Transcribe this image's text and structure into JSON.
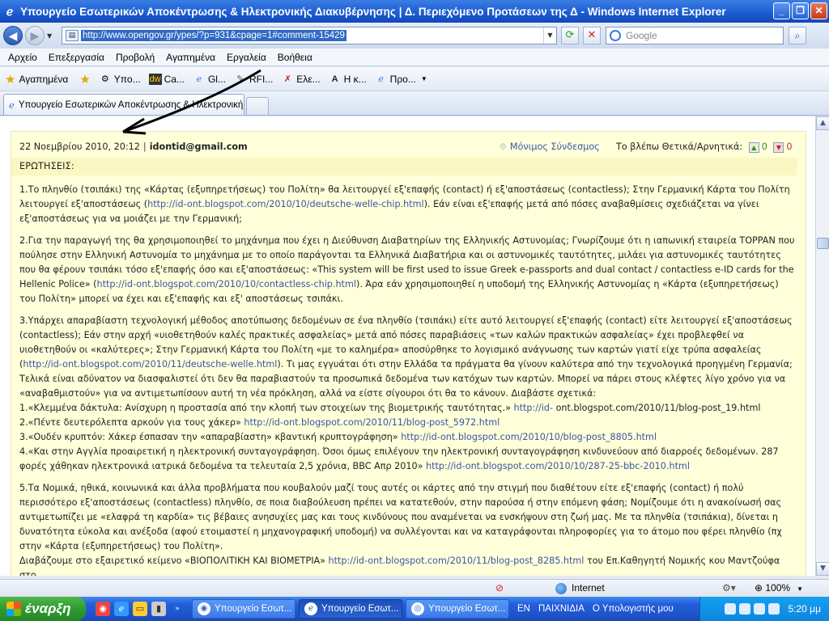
{
  "window": {
    "title": "Υπουργείο Εσωτερικών Αποκέντρωσης & Ηλεκτρονικής Διακυβέρνησης | Δ. Περιεχόμενο Προτάσεων της Δ - Windows Internet Explorer",
    "min": "_",
    "max": "❐",
    "close": "✕"
  },
  "address": {
    "url": "http://www.opengov.gr/ypes/?p=931&cpage=1#comment-15429",
    "search_placeholder": "Google"
  },
  "menu": [
    "Αρχείο",
    "Επεξεργασία",
    "Προβολή",
    "Αγαπημένα",
    "Εργαλεία",
    "Βοήθεια"
  ],
  "favorites": {
    "label": "Αγαπημένα",
    "items": [
      "Υπο...",
      "Ca...",
      "Gl...",
      "RFI...",
      "Ελε...",
      "Η κ...",
      "Προ..."
    ]
  },
  "tab": {
    "title": "Υπουργείο Εσωτερικών Αποκέντρωσης & Ηλεκτρονική..."
  },
  "comment": {
    "date": "22 Νοεμβρίου 2010, 20:12",
    "sep": "|",
    "author": "idontid@gmail.com",
    "permalink": "Μόνιμος Σύνδεσμος",
    "vote_label": "Το βλέπω Θετικά/Αρνητικά:",
    "up": "0",
    "down": "0",
    "heading": "ΕΡΩΤΗΣΕΙΣ:",
    "p1a": "1.Το πληνθίο (τσιπάκι) της «Κάρτας (εξυπηρετήσεως) του Πολίτη» θα λειτουργεί εξ'επαφής (contact) ή εξ'αποστάσεως (contactless); Στην Γερμανική Κάρτα του Πολίτη λειτουργεί εξ'αποστάσεως (",
    "p1link": "http://id-ont.blogspot.com/2010/10/deutsche-welle-chip.html",
    "p1b": "). Εάν είναι εξ'επαφής μετά από πόσες αναβαθμίσεις σχεδιάζεται να γίνει εξ'αποστάσεως για να μοιάζει με την Γερμανική;",
    "p2a": "2.Για την παραγωγή της θα χρησιμοποιηθεί το μηχάνημα που έχει η Διεύθυνση Διαβατηρίων της Ελληνικής Αστυνομίας; Γνωρίζουμε ότι η ιαπωνική εταιρεία TOPPAN που πούλησε στην Ελληνική Αστυνομία το μηχάνημα με το οποίο παράγονται τα Ελληνικά Διαβατήρια και οι αστυνομικές ταυτότητες, μιλάει για αστυνομικές ταυτότητες που θα φέρουν τσιπάκι τόσο εξ'επαφής όσο και εξ'αποστάσεως: «This system will be first used to issue Greek e-passports and dual contact / contactless e-ID cards for the Hellenic Police» (",
    "p2link": "http://id-ont.blogspot.com/2010/10/contactless-chip.html",
    "p2b": "). Άρα εάν χρησιμοποιηθεί η υποδομή της Ελληνικής Αστυνομίας η «Κάρτα (εξυπηρετήσεως) του Πολίτη» μπορεί να έχει και εξ'επαφής και εξ' αποστάσεως τσιπάκι.",
    "p3a": "3.Υπάρχει απαραβίαστη τεχνολογική μέθοδος αποτύπωσης δεδομένων σε ένα πληνθίο (τσιπάκι) είτε αυτό λειτουργεί εξ'επαφής (contact) είτε λειτουργεί εξ'αποστάσεως (contactless); Εάν στην αρχή «υιοθετηθούν καλές πρακτικές ασφαλείας» μετά από πόσες παραβιάσεις «των καλών πρακτικών ασφαλείας» έχει προβλεφθεί να υιοθετηθούν οι «καλύτερες»; Στην Γερμανική Κάρτα του Πολίτη «με το καλημέρα» αποσύρθηκε το λογισμικό ανάγνωσης των καρτών γιατί είχε τρύπα ασφαλείας (",
    "p3link": "http://id-ont.blogspot.com/2010/11/deutsche-welle.html",
    "p3b": "). Τι μας εγγυάται ότι στην Ελλάδα τα πράγματα θα γίνουν καλύτερα από την τεχνολογικά προηγμένη Γερμανία; Τελικά είναι αδύνατον να διασφαλιστεί ότι δεν θα παραβιαστούν τα προσωπικά δεδομένα των κατόχων των καρτών. Μπορεί να πάρει στους κλέφτες λίγο χρόνο για να «αναβαθμιστούν» για να αντιμετωπίσουν αυτή τη νέα πρόκληση, αλλά να είστε σίγουροι ότι θα το κάνουν. Διαβάστε σχετικά:",
    "l1a": "1.«Κλεμμένα δάκτυλα: Ανίσχυρη η προστασία από την κλοπή των στοιχείων της βιομετρικής ταυτότητας.» ",
    "l1link": "http://id-",
    "l1b": " ont.blogspot.com/2010/11/blog-post_19.html",
    "l2a": "2.«Πέντε δευτερόλεπτα αρκούν για τους χάκερ» ",
    "l2link": "http://id-ont.blogspot.com/2010/11/blog-post_5972.html",
    "l3a": "3.«Ουδέν κρυπτόν: Χάκερ έσπασαν την «απαραβίαστη» κβαντική κρυπτογράφηση» ",
    "l3link": "http://id-ont.blogspot.com/2010/10/blog-post_8805.html",
    "l4a": "4.«Και στην Αγγλία προαιρετική η ηλεκτρονική συνταγογράφηση. Όσοι όμως επιλέγουν την ηλεκτρονική συνταγογράφηση κινδυνεύουν από διαρροές δεδομένων. 287 φορές χάθηκαν ηλεκτρονικά ιατρικά δεδομένα τα τελευταία 2,5 χρόνια, BBC Απρ 2010» ",
    "l4link": "http://id-ont.blogspot.com/2010/10/287-25-bbc-2010.html",
    "p5": "5.Τα Νομικά, ηθικά, κοινωνικά και άλλα προβλήματα που κουβαλούν μαζί τους αυτές οι κάρτες από την στιγμή που διαθέτουν είτε εξ'επαφής (contact) ή πολύ περισσότερο εξ'αποστάσεως (contactless) πληνθίο, σε ποια διαβούλευση πρέπει να κατατεθούν, στην παρούσα ή στην επόμενη φάση; Νομίζουμε ότι η ανακοίνωσή σας αντιμετωπίζει με «ελαφρά τη καρδία» τις βέβαιες ανησυχίες μας και τους κινδύνους που αναμένεται να ενσκήψουν στη ζωή μας. Με τα πληνθία (τσιπάκια), δίνεται η δυνατότητα εύκολα και ανέξοδα (αφού ετοιμαστεί η μηχανογραφική υποδομή) να συλλέγονται και να καταγράφονται πληροφορίες για το άτομο που φέρει πληνθίο (πχ στην «Κάρτα (εξυπηρετήσεως) του Πολίτη».",
    "p6a": "Διαβάζουμε στο εξαιρετικό κείμενο «ΒΙΟΠΟΛΙΤΙΚΗ ΚΑΙ ΒΙΟΜΕΤΡΙΑ» ",
    "p6link": "http://id-ont.blogspot.com/2010/11/blog-post_8285.html",
    "p6b": " του Επ.Καθηγητή Νομικής κου Μαντζούφα στο"
  },
  "status": {
    "zone": "Internet",
    "zoom": "100%"
  },
  "taskbar": {
    "start": "έναρξη",
    "buttons": [
      "Υπουργείο Εσωτ...",
      "Υπουργείο Εσωτ...",
      "Υπουργείο Εσωτ..."
    ],
    "lang": "EN",
    "extra": [
      "ΠΑΙΧΝΙΔΙΑ",
      "Ο Υπολογιστής μου"
    ],
    "clock": "5:20 μμ"
  }
}
